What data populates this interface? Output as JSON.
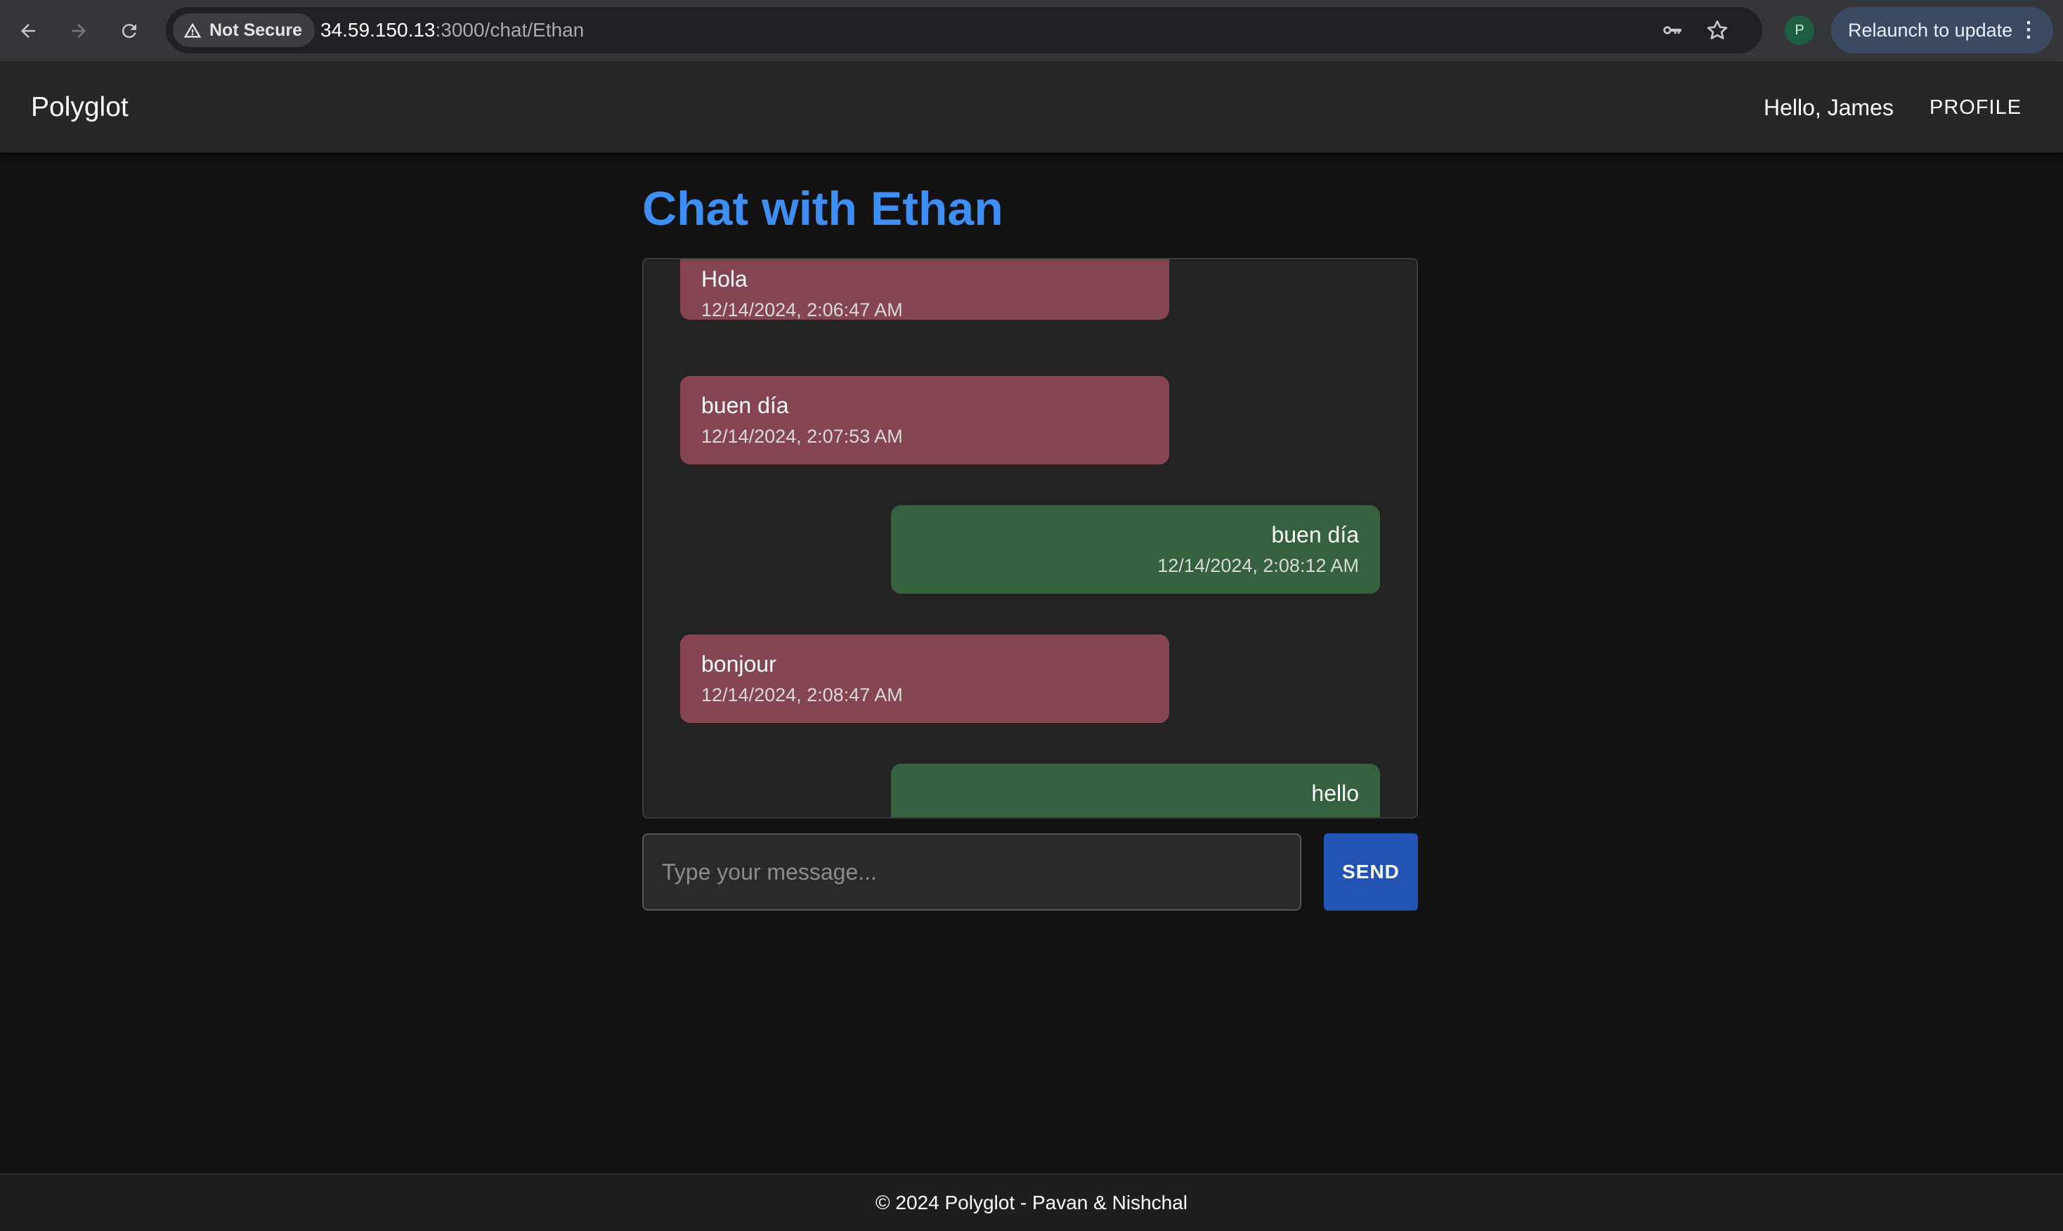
{
  "browser": {
    "security_label": "Not Secure",
    "url_host": "34.59.150.13",
    "url_path": ":3000/chat/Ethan",
    "profile_initial": "P",
    "relaunch_label": "Relaunch to update",
    "icons": [
      "back-arrow-icon",
      "forward-arrow-icon",
      "reload-icon",
      "warning-icon",
      "key-icon",
      "star-icon",
      "more-vert-icon"
    ]
  },
  "header": {
    "brand": "Polyglot",
    "greeting": "Hello, James",
    "profile_link": "PROFILE"
  },
  "chat": {
    "title": "Chat with Ethan",
    "colors": {
      "title": "#3d8ef5",
      "received_bubble": "#854552",
      "sent_bubble": "#36613f",
      "send_button": "#2354b3"
    },
    "messages": [
      {
        "direction": "received",
        "text": "Hola",
        "time": "12/14/2024, 2:06:47 AM"
      },
      {
        "direction": "received",
        "text": "buen día",
        "time": "12/14/2024, 2:07:53 AM"
      },
      {
        "direction": "sent",
        "text": "buen día",
        "time": "12/14/2024, 2:08:12 AM"
      },
      {
        "direction": "received",
        "text": "bonjour",
        "time": "12/14/2024, 2:08:47 AM"
      },
      {
        "direction": "sent",
        "text": "hello",
        "time": ""
      }
    ],
    "input_placeholder": "Type your message...",
    "input_value": "",
    "send_label": "SEND"
  },
  "footer": {
    "text": "© 2024 Polyglot - Pavan & Nishchal"
  }
}
